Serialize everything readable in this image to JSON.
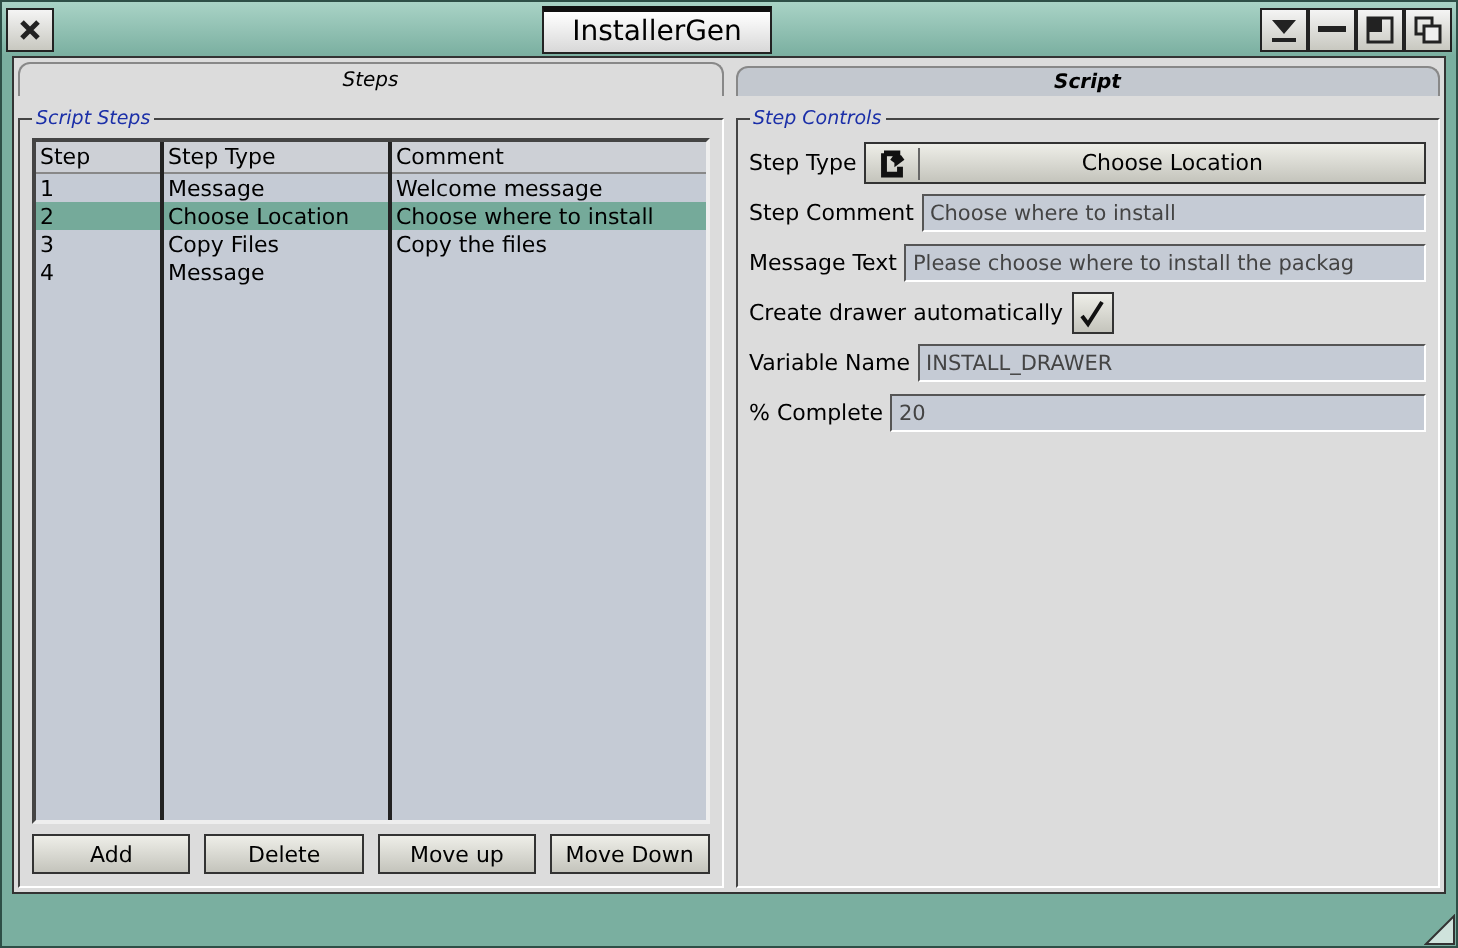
{
  "window": {
    "title": "InstallerGen"
  },
  "tabs": [
    {
      "label": "Steps",
      "selected": true
    },
    {
      "label": "Script",
      "selected": false
    }
  ],
  "script_steps": {
    "legend": "Script Steps",
    "columns": [
      "Step",
      "Step Type",
      "Comment"
    ],
    "rows": [
      {
        "cells": [
          "1",
          "Message",
          "Welcome message"
        ],
        "selected": false
      },
      {
        "cells": [
          "2",
          "Choose Location",
          "Choose where to install"
        ],
        "selected": true
      },
      {
        "cells": [
          "3",
          "Copy Files",
          "Copy the files"
        ],
        "selected": false
      },
      {
        "cells": [
          "4",
          "Message",
          ""
        ],
        "selected": false
      }
    ],
    "buttons": [
      "Add",
      "Delete",
      "Move up",
      "Move Down"
    ]
  },
  "step_controls": {
    "legend": "Step Controls",
    "fields": [
      {
        "kind": "cycle",
        "label": "Step Type",
        "value": "Choose Location"
      },
      {
        "kind": "text",
        "label": "Step Comment",
        "value": "Choose where to install"
      },
      {
        "kind": "text",
        "label": "Message Text",
        "value": "Please choose where to install the packag"
      },
      {
        "kind": "checkbox",
        "label": "Create drawer automatically",
        "checked": true
      },
      {
        "kind": "text",
        "label": "Variable Name",
        "value": "INSTALL_DRAWER"
      },
      {
        "kind": "text",
        "label": "% Complete",
        "value": "20"
      }
    ]
  }
}
